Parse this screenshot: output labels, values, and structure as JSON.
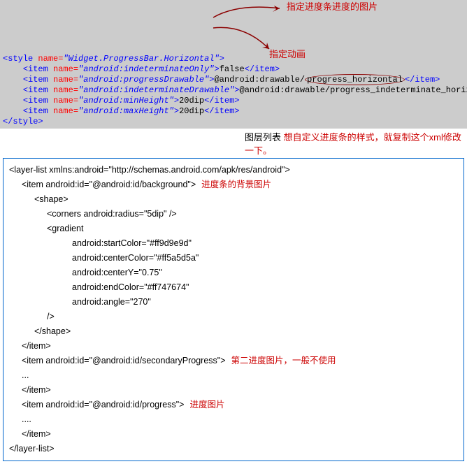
{
  "style_block": {
    "open_tag": "<style ",
    "open_attr_name": "name=",
    "open_attr_val": "\"Widget.ProgressBar.Horizontal\"",
    "open_close": ">",
    "items": [
      {
        "name": "\"android:indeterminateOnly\"",
        "value": "false"
      },
      {
        "name": "\"android:progressDrawable\"",
        "prefix": "@android:drawable/",
        "circled": "progress_horizontal",
        "suffix": ""
      },
      {
        "name": "\"android:indeterminateDrawable\"",
        "value": "@android:drawable/progress_indeterminate_horizontal"
      },
      {
        "name": "\"android:minHeight\"",
        "value": "20dip"
      },
      {
        "name": "\"android:maxHeight\"",
        "value": "20dip"
      }
    ],
    "close_tag": "</style>",
    "item_open": "<item ",
    "item_name_attr": "name=",
    "item_close_start": ">",
    "item_close_end": "</item>"
  },
  "annotations": {
    "a1": "指定进度条进度的图片",
    "a2": "指定动画",
    "a3_black": "图层列表",
    "a3_red": "想自定义进度条的样式，就复制这个xml修改一下。"
  },
  "xml": {
    "l1": "<layer-list xmlns:android=\"http://schemas.android.com/apk/res/android\">",
    "l2": "<item android:id=\"@android:id/background\">",
    "c1": "进度条的背景图片",
    "l3": "<shape>",
    "l4": "<corners android:radius=\"5dip\" />",
    "l5": "<gradient",
    "l6": "android:startColor=\"#ff9d9e9d\"",
    "l7": "android:centerColor=\"#ff5a5d5a\"",
    "l8": "android:centerY=\"0.75\"",
    "l9": "android:endColor=\"#ff747674\"",
    "l10": "android:angle=\"270\"",
    "l11": "/>",
    "l12": "</shape>",
    "l13": "</item>",
    "l14": "<item android:id=\"@android:id/secondaryProgress\">",
    "c2": "第二进度图片，一般不使用",
    "l15": "...",
    "l16": "</item>",
    "l17": "<item android:id=\"@android:id/progress\">",
    "c3": "进度图片",
    "l18": "....",
    "l19": "</item>",
    "l20": "</layer-list>"
  }
}
